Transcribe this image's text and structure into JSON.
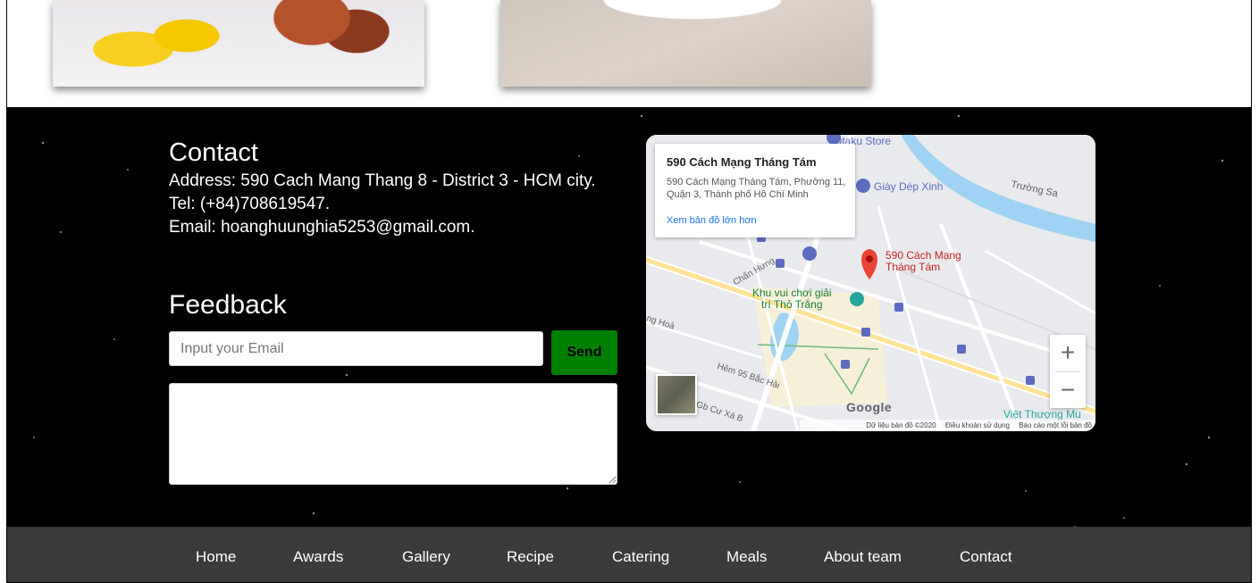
{
  "contact": {
    "title": "Contact",
    "address": "Address: 590 Cach Mang Thang 8 - District 3 - HCM city.",
    "tel": "Tel: (+84)708619547.",
    "email": "Email: hoanghuunghia5253@gmail.com."
  },
  "feedback": {
    "title": "Feedback",
    "email_placeholder": "Input your Email",
    "send_label": "Send",
    "message_value": ""
  },
  "map": {
    "card_title": "590 Cách Mạng Tháng Tám",
    "card_address": "590 Cách Mạng Tháng Tám, Phường 11, Quận 3, Thành phố Hồ Chí Minh",
    "card_link": "Xem bản đồ lớn hơn",
    "pin_label_1": "590 Cách Mạng",
    "pin_label_2": "Tháng Tám",
    "poi_otaku": "Otaku Store",
    "poi_giay": "Giày Dép Xinh",
    "poi_truong_sa": "Trường Sa",
    "poi_park_1": "Khu vui chơi giải",
    "poi_park_2": "trí Thỏ Trắng",
    "street_chan_hung": "Chấn Hưng",
    "street_hem95": "Hẻm 95 Bắc Hải",
    "street_cu_xa": "Gb Cư Xá B",
    "street_hoa": "ng Hoà",
    "poi_viet_thuong": "Việt Thượng Mu",
    "google": "Google",
    "footer_data": "Dữ liệu bản đồ ©2020",
    "footer_terms": "Điều khoản sử dụng",
    "footer_report": "Báo cáo một lỗi bản đồ",
    "zoom_in": "+",
    "zoom_out": "−"
  },
  "nav": {
    "items": [
      "Home",
      "Awards",
      "Gallery",
      "Recipe",
      "Catering",
      "Meals",
      "About team",
      "Contact"
    ]
  },
  "colors": {
    "send_button": "#008000",
    "nav_background": "#3b3b3b",
    "contact_background": "#000000",
    "map_pin": "#ea4335"
  }
}
